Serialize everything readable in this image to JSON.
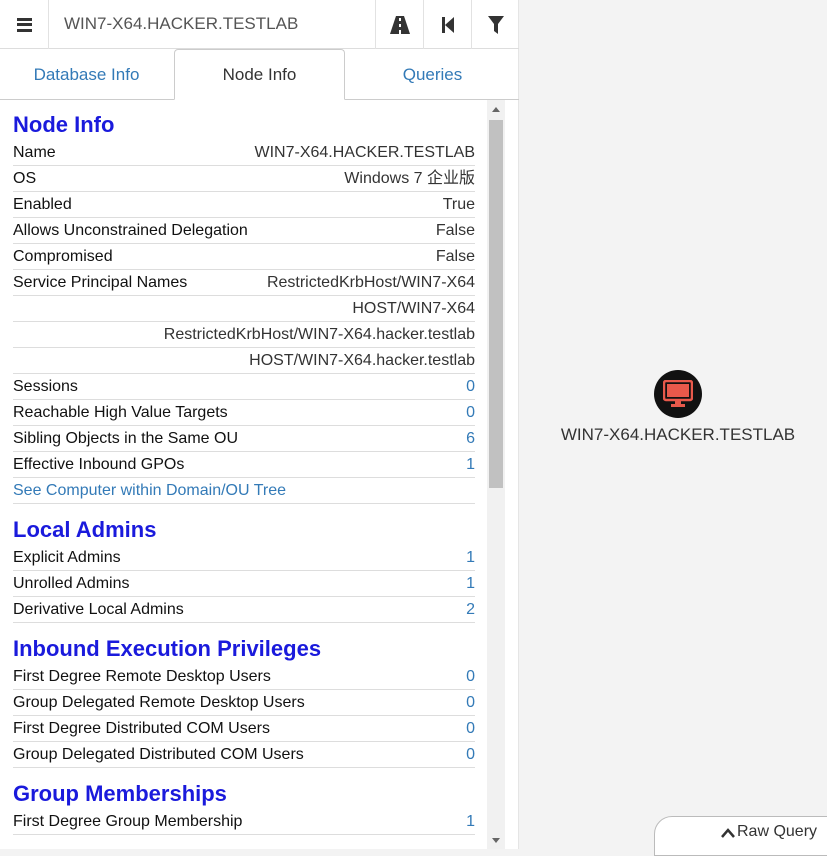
{
  "search": {
    "value": "WIN7-X64.HACKER.TESTLAB"
  },
  "tabs": [
    {
      "label": "Database Info"
    },
    {
      "label": "Node Info"
    },
    {
      "label": "Queries"
    }
  ],
  "node_info": {
    "title": "Node Info",
    "rows": [
      {
        "label": "Name",
        "value": "WIN7-X64.HACKER.TESTLAB"
      },
      {
        "label": "OS",
        "value": "Windows 7 企业版"
      },
      {
        "label": "Enabled",
        "value": "True"
      },
      {
        "label": "Allows Unconstrained Delegation",
        "value": "False"
      },
      {
        "label": "Compromised",
        "value": "False"
      },
      {
        "label": "Service Principal Names",
        "value": "RestrictedKrbHost/WIN7-X64"
      },
      {
        "label": "",
        "value": "HOST/WIN7-X64"
      },
      {
        "label": "",
        "value": "RestrictedKrbHost/WIN7-X64.hacker.testlab"
      },
      {
        "label": "",
        "value": "HOST/WIN7-X64.hacker.testlab"
      },
      {
        "label": "Sessions",
        "value": "0"
      },
      {
        "label": "Reachable High Value Targets",
        "value": "0"
      },
      {
        "label": "Sibling Objects in the Same OU",
        "value": "6"
      },
      {
        "label": "Effective Inbound GPOs",
        "value": "1"
      }
    ],
    "tree_link": "See Computer within Domain/OU Tree"
  },
  "local_admins": {
    "title": "Local Admins",
    "rows": [
      {
        "label": "Explicit Admins",
        "value": "1"
      },
      {
        "label": "Unrolled Admins",
        "value": "1"
      },
      {
        "label": "Derivative Local Admins",
        "value": "2"
      }
    ]
  },
  "inbound_exec": {
    "title": "Inbound Execution Privileges",
    "rows": [
      {
        "label": "First Degree Remote Desktop Users",
        "value": "0"
      },
      {
        "label": "Group Delegated Remote Desktop Users",
        "value": "0"
      },
      {
        "label": "First Degree Distributed COM Users",
        "value": "0"
      },
      {
        "label": "Group Delegated Distributed COM Users",
        "value": "0"
      }
    ]
  },
  "group_memberships": {
    "title": "Group Memberships",
    "rows": [
      {
        "label": "First Degree Group Membership",
        "value": "1"
      }
    ]
  },
  "graph": {
    "node_label": "WIN7-X64.HACKER.TESTLAB",
    "node_icon": "computer-icon",
    "node_icon_color": "#e8594b"
  },
  "raw_query": {
    "label": "Raw Query"
  },
  "colors": {
    "accent": "#337ab7",
    "section_title": "#1a1adc"
  }
}
